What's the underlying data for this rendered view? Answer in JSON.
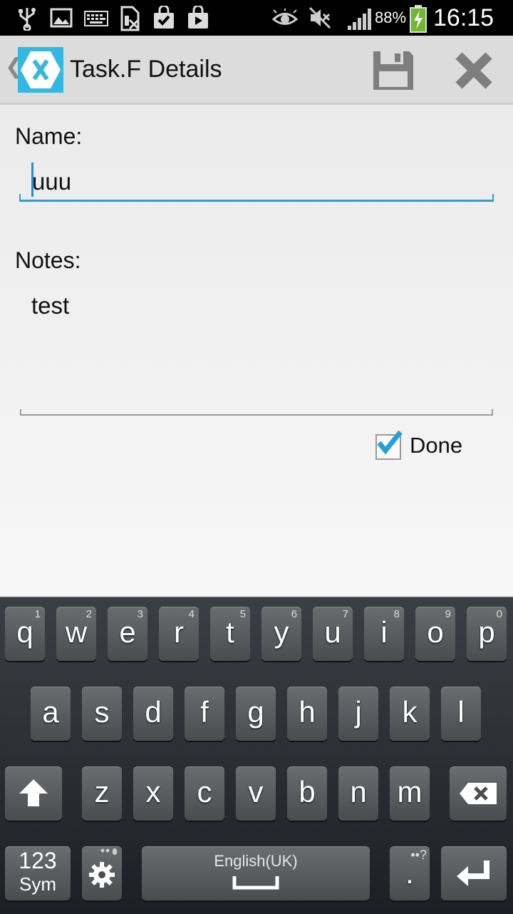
{
  "status_bar": {
    "battery_percent": "88%",
    "time": "16:15",
    "icons": [
      "usb-icon",
      "gallery-icon",
      "keyboard-icon",
      "sim-icon",
      "shopping-bag-icon",
      "play-store-icon",
      "eye-icon",
      "mute-icon",
      "signal-icon",
      "battery-charging-icon"
    ]
  },
  "action_bar": {
    "title": "Task.F Details",
    "icons": [
      "back-chevron-icon",
      "xamarin-logo-icon",
      "save-icon",
      "close-icon"
    ]
  },
  "form": {
    "name_label": "Name:",
    "name_value": "uuu",
    "notes_label": "Notes:",
    "notes_value": "test",
    "done_label": "Done",
    "done_checked": true
  },
  "colors": {
    "accent": "#2a9ed6",
    "logo": "#34b7e3",
    "actionbar": "#dcdcdc"
  },
  "keyboard": {
    "row1": [
      {
        "k": "q",
        "h": "1"
      },
      {
        "k": "w",
        "h": "2"
      },
      {
        "k": "e",
        "h": "3"
      },
      {
        "k": "r",
        "h": "4"
      },
      {
        "k": "t",
        "h": "5"
      },
      {
        "k": "y",
        "h": "6"
      },
      {
        "k": "u",
        "h": "7"
      },
      {
        "k": "i",
        "h": "8"
      },
      {
        "k": "o",
        "h": "9"
      },
      {
        "k": "p",
        "h": "0"
      }
    ],
    "row2": [
      "a",
      "s",
      "d",
      "f",
      "g",
      "h",
      "j",
      "k",
      "l"
    ],
    "row3": [
      "z",
      "x",
      "c",
      "v",
      "b",
      "n",
      "m"
    ],
    "sym_top": "123",
    "sym_bottom": "Sym",
    "space_label": "English(UK)",
    "period": ".",
    "period_hint": "••?"
  }
}
